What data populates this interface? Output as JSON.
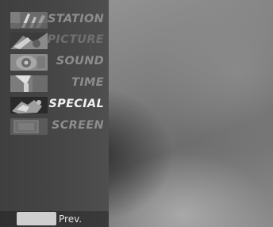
{
  "menu": {
    "items": [
      {
        "label": "STATION",
        "icon": "antenna-icon",
        "state": "normal"
      },
      {
        "label": "PICTURE",
        "icon": "picture-icon",
        "state": "dim"
      },
      {
        "label": "SOUND",
        "icon": "sound-icon",
        "state": "normal"
      },
      {
        "label": "TIME",
        "icon": "clock-icon",
        "state": "normal"
      },
      {
        "label": "SPECIAL",
        "icon": "special-icon",
        "state": "active"
      },
      {
        "label": "SCREEN",
        "icon": "screen-icon",
        "state": "normal"
      }
    ]
  },
  "footer": {
    "prev_label": "Prev.",
    "prev_button_color": "#cfcfcf"
  },
  "colors": {
    "active_label": "#f2f2f2",
    "inactive_label": "#8d8d8d"
  }
}
